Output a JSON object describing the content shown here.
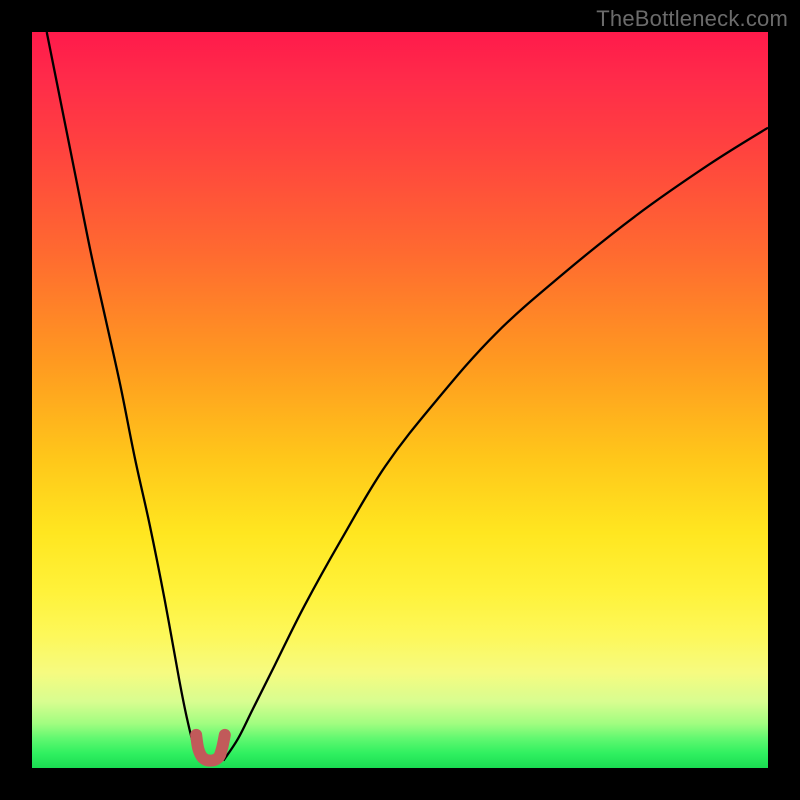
{
  "watermark": "TheBottleneck.com",
  "colors": {
    "frame": "#000000",
    "curve": "#000000",
    "marker": "#c15a5a",
    "gradient_top": "#ff1a4b",
    "gradient_bottom": "#1adc52"
  },
  "chart_data": {
    "type": "line",
    "title": "",
    "xlabel": "",
    "ylabel": "",
    "xlim": [
      0,
      100
    ],
    "ylim": [
      0,
      100
    ],
    "grid": false,
    "legend_position": "none",
    "annotations": [
      "TheBottleneck.com"
    ],
    "series": [
      {
        "name": "left-branch",
        "x": [
          2,
          4,
          6,
          8,
          10,
          12,
          14,
          16,
          18,
          20,
          21,
          22,
          23
        ],
        "y": [
          100,
          90,
          80,
          70,
          61,
          52,
          42,
          33,
          23,
          12,
          7,
          3,
          1
        ]
      },
      {
        "name": "right-branch",
        "x": [
          26,
          28,
          30,
          33,
          37,
          42,
          48,
          55,
          63,
          72,
          82,
          92,
          100
        ],
        "y": [
          1,
          4,
          8,
          14,
          22,
          31,
          41,
          50,
          59,
          67,
          75,
          82,
          87
        ]
      },
      {
        "name": "trough-marker",
        "x": [
          22.3,
          22.6,
          23.2,
          24.2,
          25.3,
          25.8,
          26.2
        ],
        "y": [
          4.5,
          2.6,
          1.4,
          1.0,
          1.4,
          2.6,
          4.5
        ]
      }
    ],
    "background_gradient_y_to_color": [
      [
        100,
        "#ff1a4b"
      ],
      [
        50,
        "#ffc71a"
      ],
      [
        20,
        "#fdf85a"
      ],
      [
        0,
        "#1adc52"
      ]
    ]
  }
}
